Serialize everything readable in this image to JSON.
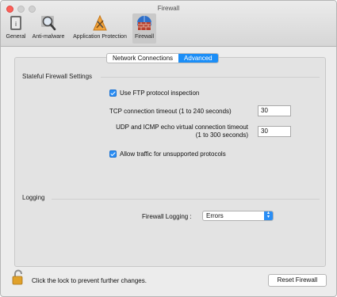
{
  "window": {
    "title": "Firewall"
  },
  "toolbar": {
    "items": [
      {
        "label": "General",
        "icon": "general-icon"
      },
      {
        "label": "Anti-malware",
        "icon": "magnifier-icon"
      },
      {
        "label": "Application Protection",
        "icon": "app-protection-icon"
      },
      {
        "label": "Firewall",
        "icon": "firewall-icon",
        "selected": true
      }
    ]
  },
  "tabs": [
    {
      "label": "Network Connections",
      "active": false
    },
    {
      "label": "Advanced",
      "active": true
    }
  ],
  "stateful": {
    "title": "Stateful Firewall Settings",
    "ftp_label": "Use FTP protocol inspection",
    "ftp_checked": true,
    "tcp_label": "TCP connection timeout (1 to 240 seconds)",
    "tcp_value": "30",
    "udp_label": "UDP and ICMP echo virtual connection timeout (1 to 300 seconds)",
    "udp_value": "30",
    "unsupported_label": "Allow traffic for unsupported protocols",
    "unsupported_checked": true
  },
  "logging": {
    "title": "Logging",
    "label": "Firewall Logging :",
    "value": "Errors"
  },
  "footer": {
    "lock_text": "Click the lock to prevent further changes.",
    "reset_label": "Reset Firewall"
  },
  "colors": {
    "accent": "#1b8ef7",
    "close": "#fc5f57"
  }
}
